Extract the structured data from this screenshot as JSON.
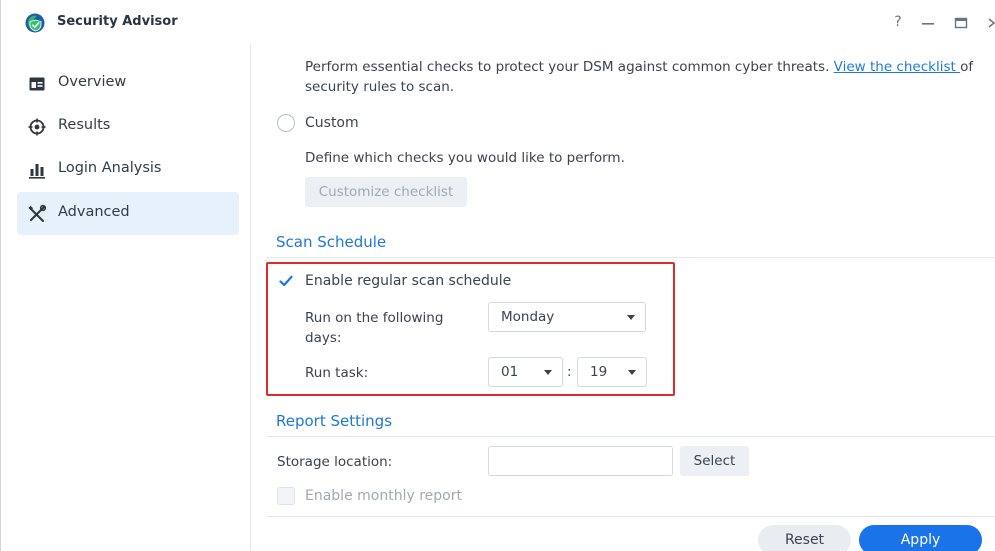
{
  "window": {
    "title": "Security Advisor",
    "help_glyph": "?"
  },
  "sidebar": {
    "items": [
      {
        "label": "Overview",
        "icon": "overview-icon"
      },
      {
        "label": "Results",
        "icon": "results-target-icon"
      },
      {
        "label": "Login Analysis",
        "icon": "bar-chart-icon"
      },
      {
        "label": "Advanced",
        "icon": "tools-icon",
        "active": true
      }
    ]
  },
  "checklist": {
    "desc_prefix": "Perform essential checks to protect your DSM against common cyber threats. ",
    "desc_link": "View the checklist ",
    "desc_suffix": "of",
    "desc_line2": "security rules to scan.",
    "custom_label": "Custom",
    "custom_desc": "Define which checks you would like to perform.",
    "customize_button": "Customize checklist"
  },
  "scan_schedule": {
    "title": "Scan Schedule",
    "enable_label": "Enable regular scan schedule",
    "enabled": true,
    "days_label_line1": "Run on the following",
    "days_label_line2": "days:",
    "days_value": "Monday",
    "run_task_label": "Run task:",
    "hour_value": "01",
    "separator": ":",
    "minute_value": "19"
  },
  "report_settings": {
    "title": "Report Settings",
    "storage_label": "Storage location:",
    "storage_value": "",
    "select_button": "Select",
    "monthly_label": "Enable monthly report",
    "monthly_enabled": false
  },
  "footer": {
    "reset_button": "Reset",
    "apply_button": "Apply"
  },
  "colors": {
    "accent": "#1a73e8",
    "section_title": "#1c78d6",
    "highlight_border": "#e02b2b",
    "active_nav_bg": "#e7f1fb"
  }
}
